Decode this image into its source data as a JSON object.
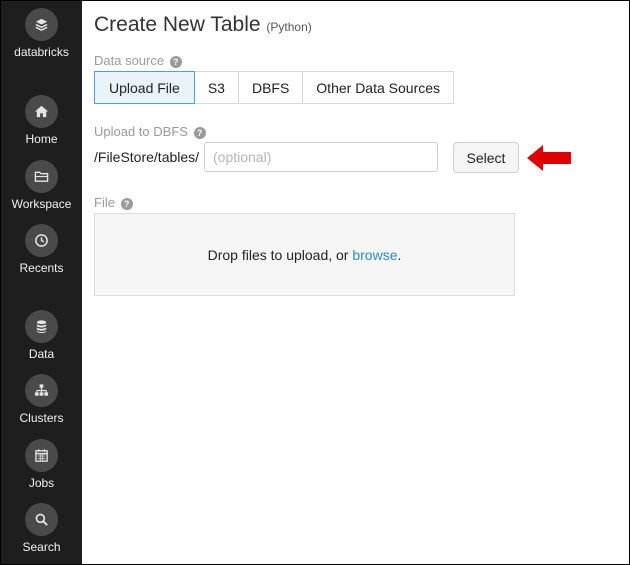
{
  "sidebar": {
    "brand": "databricks",
    "items": [
      {
        "label": "Home",
        "icon": "home-icon"
      },
      {
        "label": "Workspace",
        "icon": "folder-icon"
      },
      {
        "label": "Recents",
        "icon": "clock-icon"
      },
      {
        "label": "Data",
        "icon": "database-icon"
      },
      {
        "label": "Clusters",
        "icon": "cluster-icon"
      },
      {
        "label": "Jobs",
        "icon": "calendar-icon"
      },
      {
        "label": "Search",
        "icon": "search-icon"
      }
    ]
  },
  "page": {
    "title": "Create New Table",
    "title_suffix": "(Python)"
  },
  "data_source": {
    "label": "Data source",
    "tabs": [
      "Upload File",
      "S3",
      "DBFS",
      "Other Data Sources"
    ],
    "selected": "Upload File"
  },
  "upload": {
    "label": "Upload to DBFS",
    "prefix": "/FileStore/tables/",
    "placeholder": "(optional)",
    "value": "",
    "select_label": "Select"
  },
  "file": {
    "label": "File",
    "drop_text": "Drop files to upload, or",
    "browse_label": "browse",
    "drop_end": "."
  },
  "colors": {
    "sidebar_bg": "#1e1e1e",
    "active_tab_border": "#4aa3df",
    "link": "#2a8cc8",
    "arrow": "#e00000"
  }
}
